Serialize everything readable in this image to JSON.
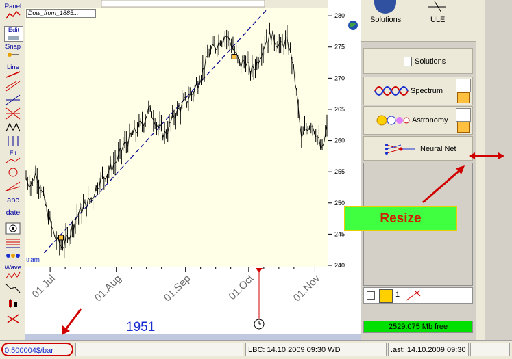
{
  "toolbar": {
    "items": [
      {
        "label": "Panel"
      },
      {
        "label": "Edit"
      },
      {
        "label": "Snap"
      },
      {
        "label": "Line"
      },
      {
        "label": "Fit"
      },
      {
        "label": "abc"
      },
      {
        "label": "date"
      },
      {
        "label": "Wave"
      }
    ]
  },
  "chart": {
    "title": "Dow_from_1885...",
    "bottom_label": "1951",
    "series_label": "tram",
    "x_ticks": [
      "01.Jul",
      "01.Aug",
      "01.Sep",
      "01.Oct",
      "01.Nov"
    ],
    "y_ticks": [
      "280",
      "275",
      "270",
      "265",
      "260",
      "255",
      "250",
      "245",
      "240"
    ]
  },
  "chart_data": {
    "type": "ohlc",
    "title": "Dow_from_1885...",
    "xlabel": "",
    "ylabel": "",
    "x_ticks": [
      "01.Jul",
      "01.Aug",
      "01.Sep",
      "01.Oct",
      "01.Nov"
    ],
    "ylim": [
      240,
      281
    ],
    "close_path": [
      254,
      253,
      255,
      252,
      249,
      246,
      244,
      243,
      244,
      246,
      248,
      249,
      250,
      251,
      253,
      254,
      255,
      256,
      257,
      259,
      260,
      261,
      262,
      263,
      265,
      264,
      262,
      261,
      262,
      264,
      265,
      266,
      267,
      268,
      270,
      272,
      274,
      275,
      276,
      277,
      276,
      274,
      272,
      273,
      271,
      272,
      274,
      276,
      277,
      276,
      275,
      276,
      274,
      268,
      260,
      262,
      263,
      261,
      258,
      262
    ],
    "trend_line": {
      "from": [
        0.06,
        242.0
      ],
      "to": [
        0.8,
        281.0
      ]
    }
  },
  "right_panel": {
    "solutions_label": "Solutions",
    "ule_label": "ULE",
    "panel_solutions_label": "Solutions",
    "spectrum_label": "Spectrum",
    "astronomy_label": "Astronomy",
    "neural_net_label": "Neural Net",
    "resize_label": "Resize",
    "count_value": "1",
    "memory_label": "2529.075 Mb free"
  },
  "status": {
    "scale": "0.500004$/bar",
    "lbc": "LBC: 14.10.2009  09:30 WD",
    "last": ".ast: 14.10.2009  09:30"
  },
  "colors": {
    "accent_red": "#d00000",
    "memory_green": "#00e000",
    "resize_green": "#40ff40",
    "resize_text": "#d02000",
    "year_blue": "#1a2fd0"
  }
}
